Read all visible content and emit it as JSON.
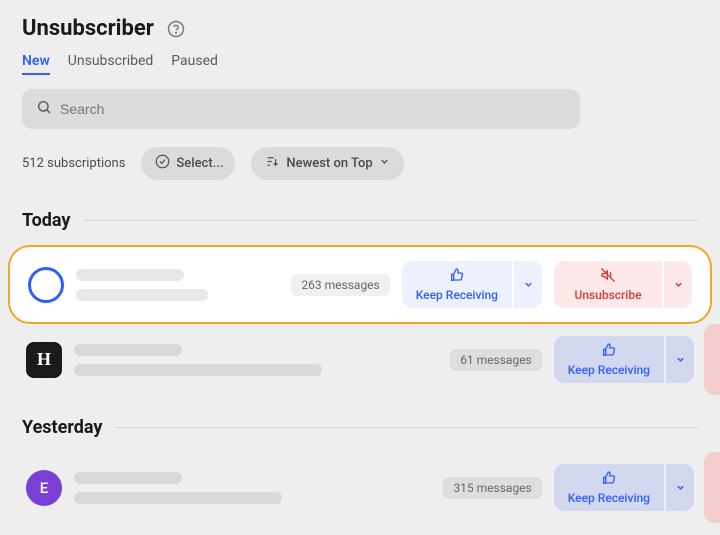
{
  "header": {
    "title": "Unsubscriber"
  },
  "tabs": {
    "new": "New",
    "unsubscribed": "Unsubscribed",
    "paused": "Paused",
    "active": "new"
  },
  "search": {
    "placeholder": "Search"
  },
  "controls": {
    "count_label": "512 subscriptions",
    "select_label": "Select...",
    "sort_label": "Newest on Top"
  },
  "sections": {
    "today": "Today",
    "yesterday": "Yesterday"
  },
  "actions": {
    "keep_receiving": "Keep Receiving",
    "unsubscribe": "Unsubscribe"
  },
  "items": [
    {
      "avatar_type": "ring",
      "avatar_letter": "",
      "messages": "263 messages",
      "highlighted": true
    },
    {
      "avatar_type": "square",
      "avatar_letter": "H",
      "messages": "61 messages",
      "highlighted": false
    },
    {
      "avatar_type": "circle",
      "avatar_letter": "E",
      "messages": "315 messages",
      "highlighted": false
    }
  ]
}
